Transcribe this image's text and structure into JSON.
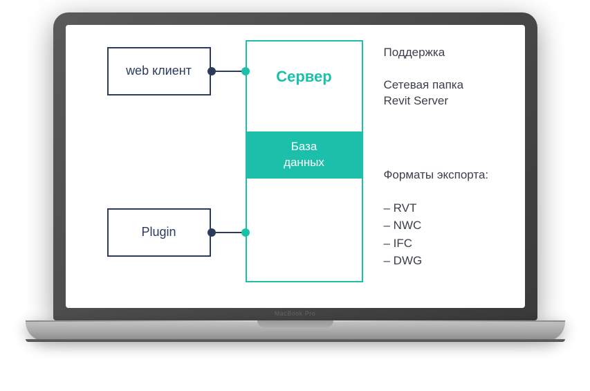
{
  "laptop": {
    "label": "MacBook Pro"
  },
  "diagram": {
    "web_client": "web клиент",
    "plugin": "Plugin",
    "server_title": "Сервер",
    "database": "База\nданных"
  },
  "sidebar": {
    "support_title": "Поддержка",
    "support_line1": "Сетевая папка",
    "support_line2": "Revit Server",
    "export_title": "Форматы экспорта:",
    "export_items": [
      "– RVT",
      "– NWC",
      "– IFC",
      "– DWG"
    ]
  }
}
